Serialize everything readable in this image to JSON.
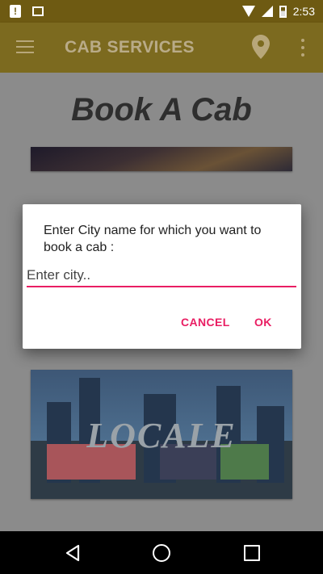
{
  "status_bar": {
    "time": "2:53"
  },
  "app_bar": {
    "title": "CAB SERVICES"
  },
  "main": {
    "page_title": "Book A Cab",
    "locale_card_label": "LOCALE"
  },
  "dialog": {
    "message": "Enter City name for which you want to book a cab :",
    "city_placeholder": "Enter city..",
    "cancel_label": "CANCEL",
    "ok_label": "OK"
  },
  "colors": {
    "accent": "#e91e63",
    "app_bar": "#7c6a1f",
    "status_bar": "#6e5a12"
  },
  "icons": [
    "notification-icon",
    "image-icon",
    "wifi-icon",
    "signal-icon",
    "battery-icon",
    "menu-icon",
    "location-icon",
    "more-icon",
    "back-icon",
    "home-icon",
    "recents-icon"
  ]
}
